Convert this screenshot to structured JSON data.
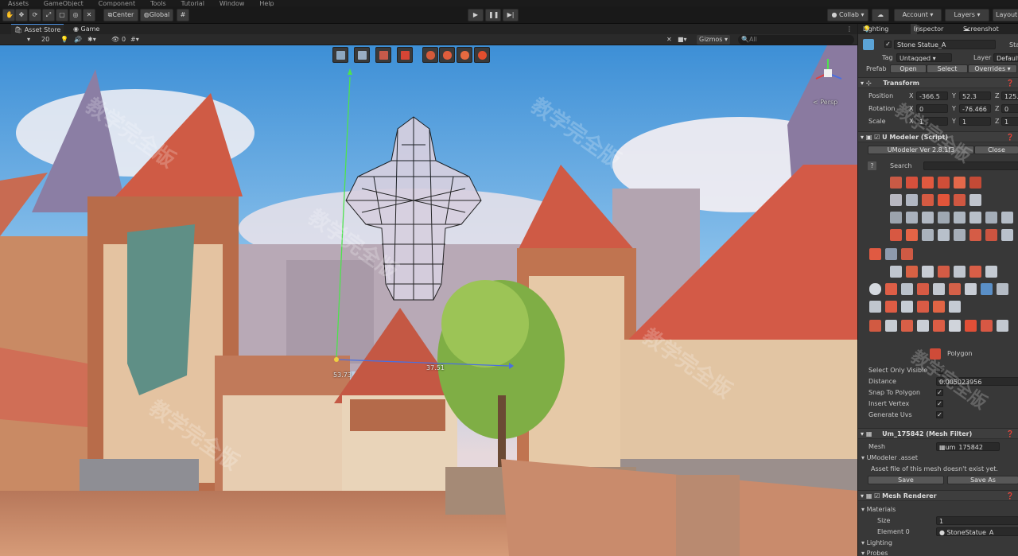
{
  "menu": [
    "Assets",
    "GameObject",
    "Component",
    "Tools",
    "Tutorial",
    "Window",
    "Help"
  ],
  "toolbar": {
    "center": "Center",
    "global": "Global",
    "collab": "Collab ▾",
    "account": "Account",
    "layers": "Layers",
    "layout": "Layout"
  },
  "tabs": {
    "asset_store": "Asset Store",
    "game": "Game"
  },
  "scene_toolbar": {
    "zoom": "20",
    "gizmos": "Gizmos",
    "search_placeholder": "All",
    "layer_count": "0"
  },
  "viewport": {
    "measure_height": "53.73",
    "measure_width": "37.51",
    "gizmo_label": "< Persp"
  },
  "inspector": {
    "tabs": {
      "lighting": "Lighting",
      "inspector": "Inspector",
      "screenshot": "Screenshot"
    },
    "object_name": "Stone Statue_A",
    "static": "Sta",
    "tag_label": "Tag",
    "tag_value": "Untagged",
    "layer_label": "Layer",
    "layer_value": "Default",
    "prefab_label": "Prefab",
    "prefab_open": "Open",
    "prefab_select": "Select",
    "prefab_overrides": "Overrides",
    "transform": {
      "title": "Transform",
      "position_label": "Position",
      "rotation_label": "Rotation",
      "scale_label": "Scale",
      "pos_x": "-366.5",
      "pos_y": "52.3",
      "pos_z": "125.1",
      "rot_x": "0",
      "rot_y": "-76.466",
      "rot_z": "0",
      "scale_x": "1",
      "scale_y": "1",
      "scale_z": "1"
    },
    "umodeler": {
      "title": "U Modeler (Script)",
      "version": "UModeler Ver 2.8.1f3",
      "close": "Close",
      "search": "Search",
      "mode": "Polygon",
      "select_only_visible": "Select Only Visible",
      "distance_label": "Distance",
      "distance_value": "0.005023956",
      "snap_to_polygon": "Snap To Polygon",
      "insert_vertex": "Insert Vertex",
      "generate_uvs": "Generate Uvs"
    },
    "mesh_filter": {
      "title": "Um_175842 (Mesh Filter)",
      "mesh_label": "Mesh",
      "mesh_value": "um_175842"
    },
    "umodeler_asset": {
      "title": "UModeler .asset",
      "message": "Asset file of this mesh doesn't exist yet.",
      "save": "Save",
      "save_as": "Save As"
    },
    "mesh_renderer": {
      "title": "Mesh Renderer",
      "materials": "Materials",
      "size_label": "Size",
      "size_value": "1",
      "element_label": "Element 0",
      "element_value": "StoneStatue_A",
      "lighting": "Lighting",
      "probes": "Probes"
    }
  },
  "watermark": "教学完全版"
}
